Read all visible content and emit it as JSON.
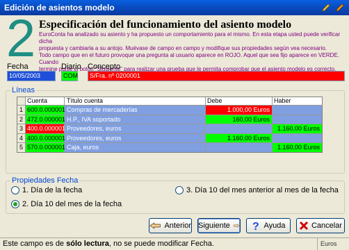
{
  "window": {
    "title": "Edición de asientos modelo"
  },
  "step": {
    "number": "2",
    "title": "Especificación del funcionamiento del asiento modelo",
    "description_lines": [
      "EuroConta ha analizado su asiento y ha propuesto un comportamiento para el mismo. En esta etapa usted puede verificar dicha",
      "propuesta y cambiarla a su antojo. Muévase de campo en campo y modifique sus propiedades según vea necesario.",
      "Todo campo que en el futuro provoque una pregunta al usuario aparece en ROJO. Aquel que sea fijo aparece en VERDE. Cuando",
      "termine pulse el botón \"Siguiente\" para realizar una prueba que le permita comprobar que el asiento modelo es correcto."
    ]
  },
  "fields": {
    "fecha": {
      "label": "Fecha",
      "value": "10/05/2003"
    },
    "diario": {
      "label": "Diario",
      "value": "COM"
    },
    "concepto": {
      "label": "Concepto",
      "value": "S/Fra. nº 0200001"
    }
  },
  "lines": {
    "group_title": "Líneas",
    "columns": [
      "Cuenta",
      "Título cuenta",
      "Debe",
      "Haber"
    ],
    "rows": [
      {
        "n": "1",
        "cuenta": "600.0.000001",
        "titulo": "Compras de mercaderías",
        "debe": "1.000,00 Euros",
        "haber": ""
      },
      {
        "n": "2",
        "cuenta": "472.0.000001",
        "titulo": "H.P., IVA soportado",
        "debe": "160,00 Euros",
        "haber": ""
      },
      {
        "n": "3",
        "cuenta": "400.0.000001",
        "titulo": "Proveedores, euros",
        "debe": "",
        "haber": "1.160,00 Euros"
      },
      {
        "n": "4",
        "cuenta": "400.0.000001",
        "titulo": "Proveedores, euros",
        "debe": "1.160,00 Euros",
        "haber": ""
      },
      {
        "n": "5",
        "cuenta": "570.0.000001",
        "titulo": "Caja, euros",
        "debe": "",
        "haber": "1.160,00 Euros"
      }
    ]
  },
  "fecha_props": {
    "group_title": "Propiedades Fecha",
    "options": [
      {
        "label": "1. Día de la fecha",
        "selected": false
      },
      {
        "label": "2. Día 10 del mes de la fecha",
        "selected": true
      },
      {
        "label": "3. Día 10 del mes anterior al mes de la fecha",
        "selected": false
      }
    ]
  },
  "buttons": {
    "anterior": "Anterior",
    "siguiente": "Siguiente",
    "ayuda": "Ayuda",
    "cancelar": "Cancelar"
  },
  "status": {
    "message_prefix": "Este campo es de ",
    "message_bold": "sólo lectura",
    "message_suffix": ", no se puede modificar Fecha.",
    "currency": "Euros"
  },
  "colors": {
    "red": "#ff0000",
    "green": "#00ff00",
    "blue_cell": "#7f9fe0",
    "selected_blue": "#1f4fd8",
    "teal_number": "#1f8e84",
    "desc_purple": "#800080"
  }
}
